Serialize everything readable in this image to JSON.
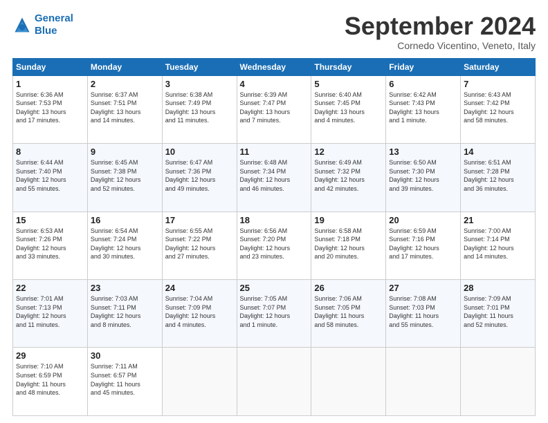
{
  "logo": {
    "line1": "General",
    "line2": "Blue"
  },
  "title": "September 2024",
  "subtitle": "Cornedo Vicentino, Veneto, Italy",
  "header_days": [
    "Sunday",
    "Monday",
    "Tuesday",
    "Wednesday",
    "Thursday",
    "Friday",
    "Saturday"
  ],
  "weeks": [
    [
      {
        "day": "1",
        "info": "Sunrise: 6:36 AM\nSunset: 7:53 PM\nDaylight: 13 hours\nand 17 minutes."
      },
      {
        "day": "2",
        "info": "Sunrise: 6:37 AM\nSunset: 7:51 PM\nDaylight: 13 hours\nand 14 minutes."
      },
      {
        "day": "3",
        "info": "Sunrise: 6:38 AM\nSunset: 7:49 PM\nDaylight: 13 hours\nand 11 minutes."
      },
      {
        "day": "4",
        "info": "Sunrise: 6:39 AM\nSunset: 7:47 PM\nDaylight: 13 hours\nand 7 minutes."
      },
      {
        "day": "5",
        "info": "Sunrise: 6:40 AM\nSunset: 7:45 PM\nDaylight: 13 hours\nand 4 minutes."
      },
      {
        "day": "6",
        "info": "Sunrise: 6:42 AM\nSunset: 7:43 PM\nDaylight: 13 hours\nand 1 minute."
      },
      {
        "day": "7",
        "info": "Sunrise: 6:43 AM\nSunset: 7:42 PM\nDaylight: 12 hours\nand 58 minutes."
      }
    ],
    [
      {
        "day": "8",
        "info": "Sunrise: 6:44 AM\nSunset: 7:40 PM\nDaylight: 12 hours\nand 55 minutes."
      },
      {
        "day": "9",
        "info": "Sunrise: 6:45 AM\nSunset: 7:38 PM\nDaylight: 12 hours\nand 52 minutes."
      },
      {
        "day": "10",
        "info": "Sunrise: 6:47 AM\nSunset: 7:36 PM\nDaylight: 12 hours\nand 49 minutes."
      },
      {
        "day": "11",
        "info": "Sunrise: 6:48 AM\nSunset: 7:34 PM\nDaylight: 12 hours\nand 46 minutes."
      },
      {
        "day": "12",
        "info": "Sunrise: 6:49 AM\nSunset: 7:32 PM\nDaylight: 12 hours\nand 42 minutes."
      },
      {
        "day": "13",
        "info": "Sunrise: 6:50 AM\nSunset: 7:30 PM\nDaylight: 12 hours\nand 39 minutes."
      },
      {
        "day": "14",
        "info": "Sunrise: 6:51 AM\nSunset: 7:28 PM\nDaylight: 12 hours\nand 36 minutes."
      }
    ],
    [
      {
        "day": "15",
        "info": "Sunrise: 6:53 AM\nSunset: 7:26 PM\nDaylight: 12 hours\nand 33 minutes."
      },
      {
        "day": "16",
        "info": "Sunrise: 6:54 AM\nSunset: 7:24 PM\nDaylight: 12 hours\nand 30 minutes."
      },
      {
        "day": "17",
        "info": "Sunrise: 6:55 AM\nSunset: 7:22 PM\nDaylight: 12 hours\nand 27 minutes."
      },
      {
        "day": "18",
        "info": "Sunrise: 6:56 AM\nSunset: 7:20 PM\nDaylight: 12 hours\nand 23 minutes."
      },
      {
        "day": "19",
        "info": "Sunrise: 6:58 AM\nSunset: 7:18 PM\nDaylight: 12 hours\nand 20 minutes."
      },
      {
        "day": "20",
        "info": "Sunrise: 6:59 AM\nSunset: 7:16 PM\nDaylight: 12 hours\nand 17 minutes."
      },
      {
        "day": "21",
        "info": "Sunrise: 7:00 AM\nSunset: 7:14 PM\nDaylight: 12 hours\nand 14 minutes."
      }
    ],
    [
      {
        "day": "22",
        "info": "Sunrise: 7:01 AM\nSunset: 7:13 PM\nDaylight: 12 hours\nand 11 minutes."
      },
      {
        "day": "23",
        "info": "Sunrise: 7:03 AM\nSunset: 7:11 PM\nDaylight: 12 hours\nand 8 minutes."
      },
      {
        "day": "24",
        "info": "Sunrise: 7:04 AM\nSunset: 7:09 PM\nDaylight: 12 hours\nand 4 minutes."
      },
      {
        "day": "25",
        "info": "Sunrise: 7:05 AM\nSunset: 7:07 PM\nDaylight: 12 hours\nand 1 minute."
      },
      {
        "day": "26",
        "info": "Sunrise: 7:06 AM\nSunset: 7:05 PM\nDaylight: 11 hours\nand 58 minutes."
      },
      {
        "day": "27",
        "info": "Sunrise: 7:08 AM\nSunset: 7:03 PM\nDaylight: 11 hours\nand 55 minutes."
      },
      {
        "day": "28",
        "info": "Sunrise: 7:09 AM\nSunset: 7:01 PM\nDaylight: 11 hours\nand 52 minutes."
      }
    ],
    [
      {
        "day": "29",
        "info": "Sunrise: 7:10 AM\nSunset: 6:59 PM\nDaylight: 11 hours\nand 48 minutes."
      },
      {
        "day": "30",
        "info": "Sunrise: 7:11 AM\nSunset: 6:57 PM\nDaylight: 11 hours\nand 45 minutes."
      },
      {
        "day": "",
        "info": ""
      },
      {
        "day": "",
        "info": ""
      },
      {
        "day": "",
        "info": ""
      },
      {
        "day": "",
        "info": ""
      },
      {
        "day": "",
        "info": ""
      }
    ]
  ]
}
